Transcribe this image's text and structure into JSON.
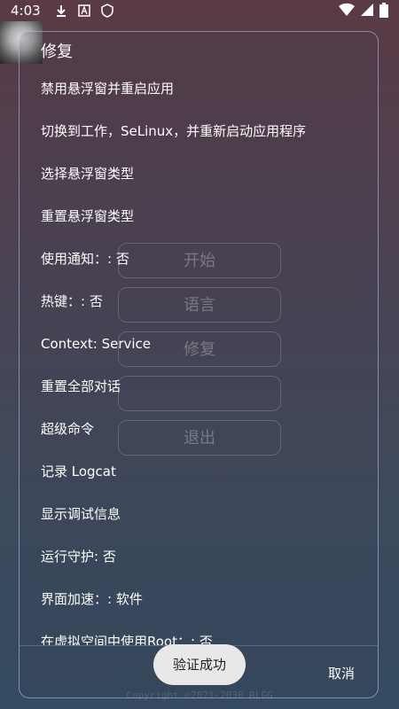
{
  "status": {
    "time": "4:03"
  },
  "dialog": {
    "title": "修复",
    "items": [
      "禁用悬浮窗并重启应用",
      "切换到工作，SeLinux，并重新启动应用程序",
      "选择悬浮窗类型",
      "重置悬浮窗类型",
      "使用通知：: 否",
      "热键：: 否",
      "Context: Service",
      "重置全部对话",
      "超级命令",
      "记录 Logcat",
      "显示调试信息",
      "运行守护: 否",
      "界面加速：: 软件",
      "在虚拟空间中使用Root：: 否"
    ],
    "cancel": "取消"
  },
  "background_menu": [
    "开始",
    "语言",
    "修复",
    "",
    "退出"
  ],
  "toast": "验证成功",
  "footer": "Copyright ©2021-2030 RLGG",
  "colors": {
    "dialog_border": "#bec8ff",
    "toast_bg": "#e8e8e8"
  }
}
